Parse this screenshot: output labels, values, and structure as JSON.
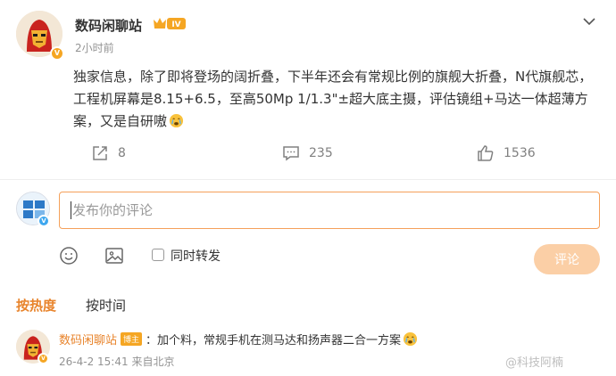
{
  "post": {
    "author": "数码闲聊站",
    "level_badge": "IV",
    "time": "2小时前",
    "text": "独家信息，除了即将登场的阔折叠，下半年还会有常规比例的旗舰大折叠，N代旗舰芯，工程机屏幕是8.15+6.5，至高50Mp 1/1.3\"±超大底主摄，评估镜组+马达一体超薄方案，又是自研嗷",
    "actions": {
      "repost_count": "8",
      "comment_count": "235",
      "like_count": "1536"
    }
  },
  "compose": {
    "placeholder": "发布你的评论",
    "repost_label": "同时转发",
    "submit_label": "评论"
  },
  "sort": {
    "hot": "按热度",
    "time": "按时间"
  },
  "comment": {
    "author": "数码闲聊站",
    "tag": "博主",
    "text": "：加个料，常规手机在测马达和扬声器二合一方案",
    "time": "26-4-2 15:41",
    "location": "来自北京"
  },
  "watermark": "@科技阿楠",
  "icons": {
    "more": "chevron-down-icon",
    "repost": "repost-icon",
    "comment": "comment-icon",
    "like": "thumbs-up-icon",
    "emoji": "emoji-icon",
    "image": "image-icon"
  },
  "colors": {
    "accent": "#e8842c",
    "submit_disabled": "#fbcfa6",
    "input_border": "#f5a05a"
  }
}
